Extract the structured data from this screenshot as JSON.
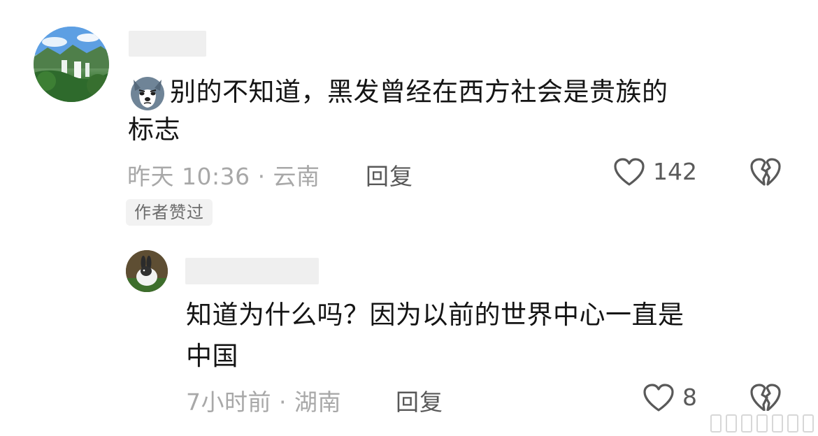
{
  "comments": [
    {
      "text_line1": "别的不知道，黑发曾经在西方社会是贵族的",
      "text_line2": "标志",
      "emoji_icon": "husky-dog-emoji",
      "time_location": "昨天 10:36 · 云南",
      "reply_label": "回复",
      "like_count": "142",
      "badge": "作者赞过"
    },
    {
      "text_line1": "知道为什么吗？因为以前的世界中心一直是",
      "text_line2": "中国",
      "time_location": "7小时前 · 湖南",
      "reply_label": "回复",
      "like_count": "8"
    }
  ],
  "colors": {
    "text": "#141414",
    "meta": "#a8a8a8",
    "reply": "#585858",
    "badge_bg": "#f2f2f2"
  }
}
